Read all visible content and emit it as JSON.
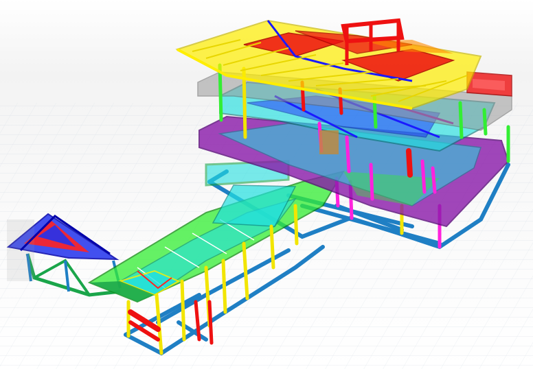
{
  "scene": {
    "subject": "structural-frame-3d-model",
    "members": [
      {
        "name": "roof-truss-yellow",
        "color": "#ffee00"
      },
      {
        "name": "slab-red",
        "color": "#ee1111"
      },
      {
        "name": "slab-cyan",
        "color": "#22e0e0"
      },
      {
        "name": "beam-blue",
        "color": "#1a1aff"
      },
      {
        "name": "beam-purple",
        "color": "#8a1aaa"
      },
      {
        "name": "slab-green",
        "color": "#33ee33"
      },
      {
        "name": "column-magenta",
        "color": "#ff22dd"
      },
      {
        "name": "foundation-steel-blue",
        "color": "#1f7fc4"
      },
      {
        "name": "cladding-gray",
        "color": "#9a9a9a"
      },
      {
        "name": "column-yellow",
        "color": "#f2e500"
      }
    ],
    "background": "#ffffff"
  }
}
